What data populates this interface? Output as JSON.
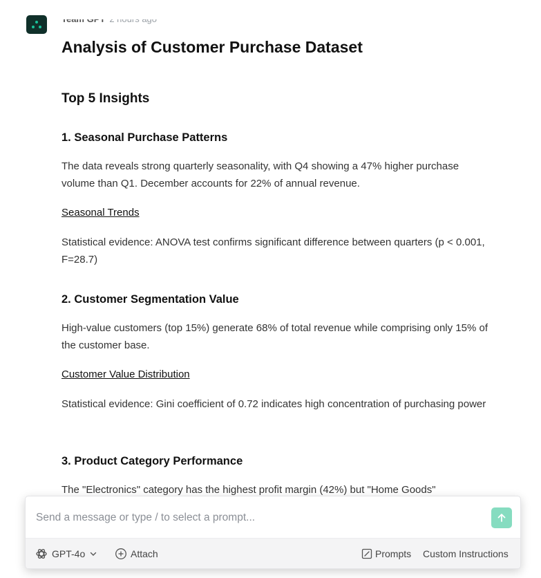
{
  "message": {
    "author": "Team GPT",
    "time": "2 hours ago",
    "title": "Analysis of Customer Purchase Dataset",
    "section_heading": "Top 5 Insights",
    "insights": [
      {
        "heading": "1. Seasonal Purchase Patterns",
        "body": "The data reveals strong quarterly seasonality, with Q4 showing a 47% higher purchase volume than Q1. December accounts for 22% of annual revenue.",
        "link": "Seasonal Trends",
        "evidence": "Statistical evidence: ANOVA test confirms significant difference between quarters (p < 0.001, F=28.7)"
      },
      {
        "heading": "2. Customer Segmentation Value",
        "body": "High-value customers (top 15%) generate 68% of total revenue while comprising only 15% of the customer base.",
        "link": "Customer Value Distribution",
        "evidence": "Statistical evidence: Gini coefficient of 0.72 indicates high concentration of purchasing power"
      },
      {
        "heading": "3. Product Category Performance",
        "body": "The \"Electronics\" category has the highest profit margin (42%) but \"Home Goods\""
      }
    ]
  },
  "composer": {
    "placeholder": "Send a message or type / to select a prompt...",
    "model_label": "GPT-4o",
    "attach_label": "Attach",
    "prompts_label": "Prompts",
    "custom_instructions_label": "Custom Instructions"
  },
  "colors": {
    "accent": "#86dcc0",
    "avatar_bg": "#10302a",
    "avatar_dot": "#19c39a"
  }
}
